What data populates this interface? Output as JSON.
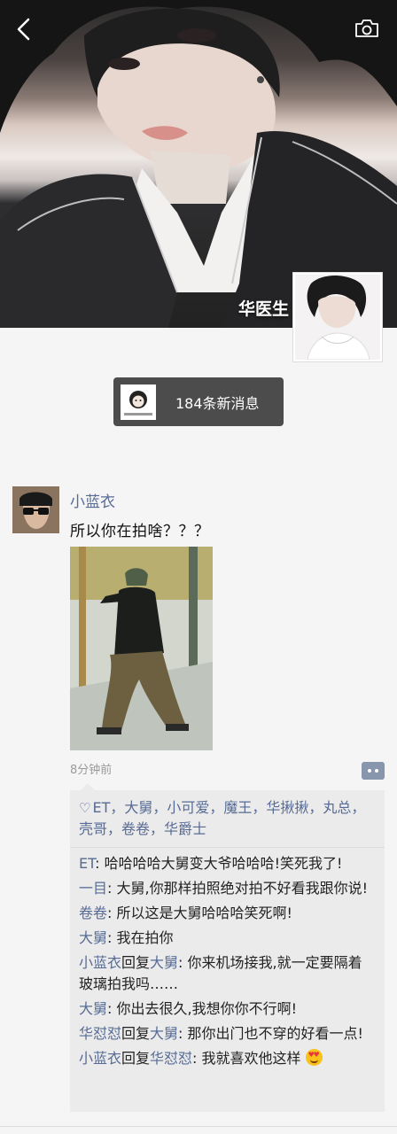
{
  "header": {
    "nickname": "华医生",
    "back_icon": "chevron-left-icon",
    "camera_icon": "camera-icon"
  },
  "notice": {
    "count_text": "184条新消息"
  },
  "post": {
    "author": "小蓝衣",
    "text": "所以你在拍啥？？？",
    "time": "8分钟前",
    "likes": "ET，大舅，小可爱，魔王，华揪揪，丸总，壳哥，卷卷，华爵士",
    "comments": [
      {
        "name": "ET",
        "text": ": 哈哈哈哈大舅变大爷哈哈哈!笑死我了!"
      },
      {
        "name": "一目",
        "text": ": 大舅,你那样拍照绝对拍不好看我跟你说!"
      },
      {
        "name": "卷卷",
        "text": ": 所以这是大舅哈哈哈笑死啊!"
      },
      {
        "name": "大舅",
        "text": ": 我在拍你"
      },
      {
        "name": "小蓝衣",
        "reply_word": "回复",
        "to": "大舅",
        "text": ": 你来机场接我,就一定要隔着玻璃拍我吗……"
      },
      {
        "name": "大舅",
        "text": ": 你出去很久,我想你你不行啊!"
      },
      {
        "name": "华怼怼",
        "reply_word": "回复",
        "to": "大舅",
        "text": ": 那你出门也不穿的好看一点!"
      },
      {
        "name": "小蓝衣",
        "reply_word": "回复",
        "to": "华怼怼",
        "text": ": 我就喜欢他这样"
      }
    ]
  },
  "colors": {
    "link": "#576b95",
    "pill": "#4c4c4c",
    "comment_bg": "#ebebeb"
  }
}
